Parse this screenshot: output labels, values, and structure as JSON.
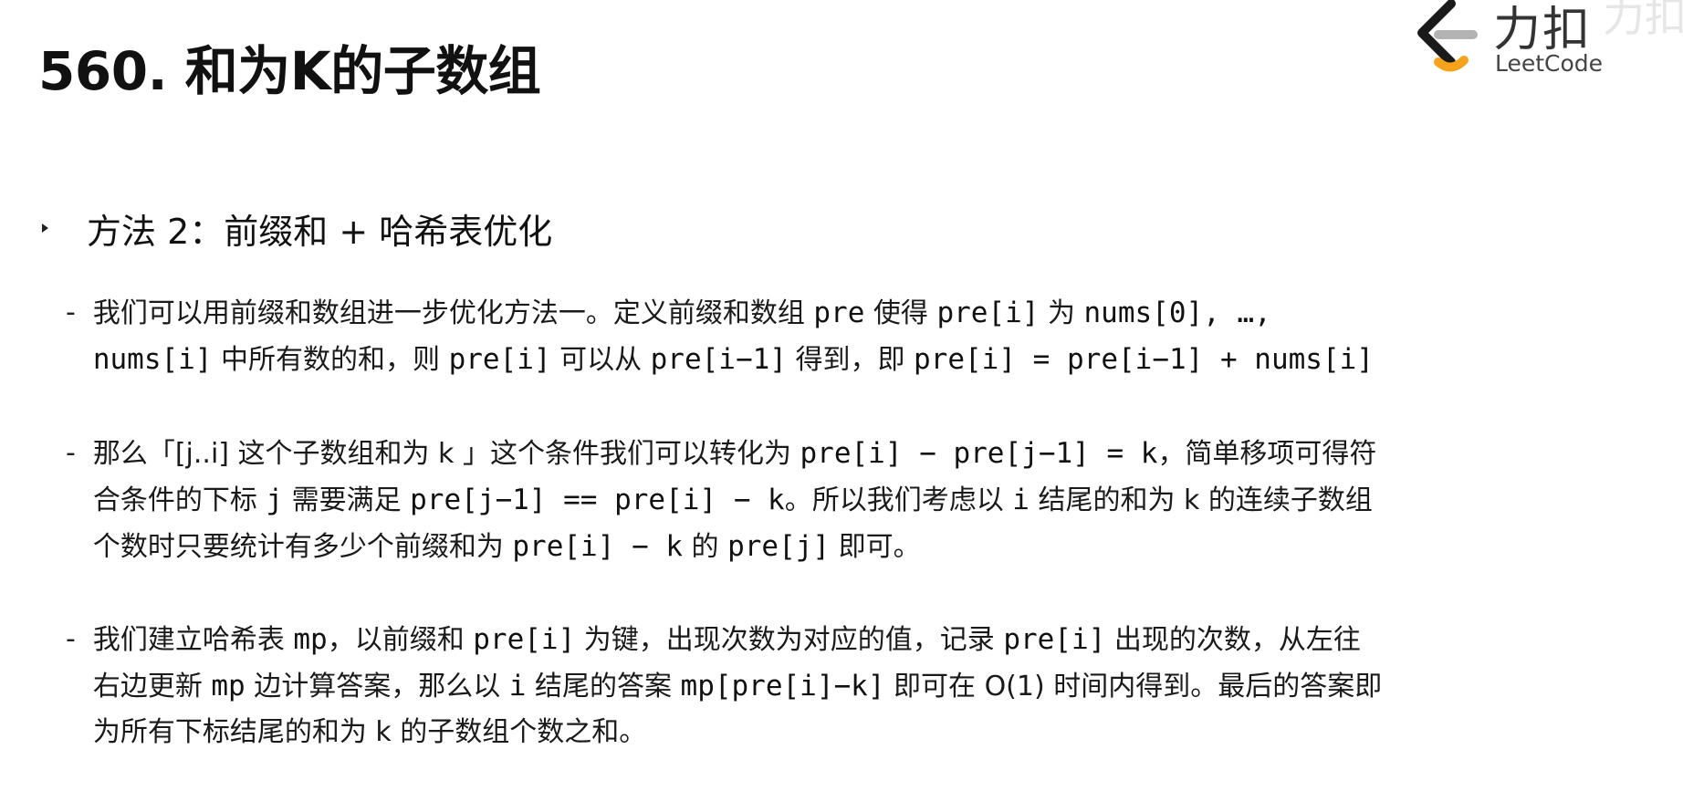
{
  "title": "560. 和为K的子数组",
  "logo": {
    "cn": "力扣",
    "en": "LeetCode",
    "watermark": "力扣"
  },
  "section": {
    "title": "方法 2：前缀和 + 哈希表优化"
  },
  "points": [
    {
      "lines": [
        [
          {
            "t": "我们可以用前缀和数组进一步优化方法一。定义前缀和数组 "
          },
          {
            "t": "pre",
            "code": true
          },
          {
            "t": " 使得 "
          },
          {
            "t": "pre[i]",
            "code": true
          },
          {
            "t": " 为 "
          },
          {
            "t": "nums[0], …,",
            "code": true
          }
        ],
        [
          {
            "t": "nums[i]",
            "code": true
          },
          {
            "t": " 中所有数的和，则 "
          },
          {
            "t": "pre[i]",
            "code": true
          },
          {
            "t": " 可以从 "
          },
          {
            "t": "pre[i−1]",
            "code": true
          },
          {
            "t": " 得到，即 "
          },
          {
            "t": "pre[i] = pre[i−1] + nums[i]",
            "code": true
          }
        ]
      ]
    },
    {
      "lines": [
        [
          {
            "t": "那么「[j..i] 这个子数组和为 k 」这个条件我们可以转化为 "
          },
          {
            "t": "pre[i] − pre[j−1] = k",
            "code": true
          },
          {
            "t": "，简单移项可得符"
          }
        ],
        [
          {
            "t": "合条件的下标 "
          },
          {
            "t": "j",
            "code": true
          },
          {
            "t": " 需要满足 "
          },
          {
            "t": "pre[j−1] == pre[i] − k",
            "code": true
          },
          {
            "t": "。所以我们考虑以 "
          },
          {
            "t": "i",
            "code": true
          },
          {
            "t": " 结尾的和为 k 的连续子数组"
          }
        ],
        [
          {
            "t": "个数时只要统计有多少个前缀和为 "
          },
          {
            "t": "pre[i] − k",
            "code": true
          },
          {
            "t": " 的 "
          },
          {
            "t": "pre[j]",
            "code": true
          },
          {
            "t": " 即可。"
          }
        ]
      ]
    },
    {
      "lines": [
        [
          {
            "t": "我们建立哈希表 "
          },
          {
            "t": "mp",
            "code": true
          },
          {
            "t": "，以前缀和 "
          },
          {
            "t": "pre[i]",
            "code": true
          },
          {
            "t": " 为键，出现次数为对应的值，记录 "
          },
          {
            "t": "pre[i]",
            "code": true
          },
          {
            "t": " 出现的次数，从左往"
          }
        ],
        [
          {
            "t": "右边更新 "
          },
          {
            "t": "mp",
            "code": true
          },
          {
            "t": " 边计算答案，那么以 "
          },
          {
            "t": "i",
            "code": true
          },
          {
            "t": " 结尾的答案 "
          },
          {
            "t": "mp[pre[i]−k]",
            "code": true
          },
          {
            "t": " 即可在 O(1) 时间内得到。最后的答案即"
          }
        ],
        [
          {
            "t": "为所有下标结尾的和为 k 的子数组个数之和。"
          }
        ]
      ]
    }
  ],
  "colors": {
    "logo_orange": "#f7a21b",
    "logo_gray": "#b3b3b3",
    "logo_dark": "#1a1a1a"
  }
}
